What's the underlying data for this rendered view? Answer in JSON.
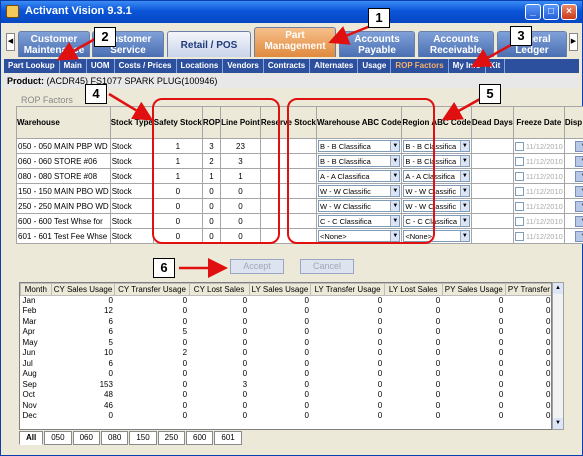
{
  "window": {
    "title": "Activant Vision 9.3.1"
  },
  "tabs": [
    {
      "label": "Customer Maintenance"
    },
    {
      "label": "Customer Service"
    },
    {
      "label": "Retail / POS"
    },
    {
      "label": "Part Management"
    },
    {
      "label": "Accounts Payable"
    },
    {
      "label": "Accounts Receivable"
    },
    {
      "label": "General Ledger"
    }
  ],
  "subnav": [
    "Part Lookup",
    "Main",
    "UOM",
    "Costs / Prices",
    "Locations",
    "Vendors",
    "Contracts",
    "Alternates",
    "Usage",
    "ROP Factors",
    "My Info",
    "Kit"
  ],
  "product": {
    "label": "Product:",
    "value": "(ACDR45) FS1077 SPARK PLUG(100946)"
  },
  "section": {
    "label": "ROP Factors"
  },
  "grid": {
    "headers": [
      "Warehouse",
      "Stock Type",
      "Safety Stock",
      "ROP",
      "Line Point",
      "Reserve Stock",
      "Warehouse ABC Code",
      "Region ABC Code",
      "Dead Days",
      "Freeze Date",
      "Disp Calc"
    ],
    "rows": [
      {
        "warehouse": "050 - 050 MAIN PBP WD",
        "type": "Stock",
        "safety": "1",
        "rop": "3",
        "line": "23",
        "wabc": "B - B Classifica",
        "rabc": "B - B Classifica",
        "date": "11/12/2010"
      },
      {
        "warehouse": "060 - 060 STORE #06",
        "type": "Stock",
        "safety": "1",
        "rop": "2",
        "line": "3",
        "wabc": "B - B Classifica",
        "rabc": "B - B Classifica",
        "date": "11/12/2010"
      },
      {
        "warehouse": "080 - 080 STORE #08",
        "type": "Stock",
        "safety": "1",
        "rop": "1",
        "line": "1",
        "wabc": "A - A Classifica",
        "rabc": "A - A Classifica",
        "date": "11/12/2010"
      },
      {
        "warehouse": "150 - 150 MAIN PBO WD",
        "type": "Stock",
        "safety": "0",
        "rop": "0",
        "line": "0",
        "wabc": "W - W Classific",
        "rabc": "W - W Classific",
        "date": "11/12/2010"
      },
      {
        "warehouse": "250 - 250 MAIN PBO WD",
        "type": "Stock",
        "safety": "0",
        "rop": "0",
        "line": "0",
        "wabc": "W - W Classific",
        "rabc": "W - W Classific",
        "date": "11/12/2010"
      },
      {
        "warehouse": "600 - 600 Test Whse for",
        "type": "Stock",
        "safety": "0",
        "rop": "0",
        "line": "0",
        "wabc": "C - C Classifica",
        "rabc": "C - C Classifica",
        "date": "11/12/2010"
      },
      {
        "warehouse": "601 - 601 Test Fee Whse",
        "type": "Stock",
        "safety": "0",
        "rop": "0",
        "line": "0",
        "wabc": "<None>",
        "rabc": "<None>",
        "date": "11/12/2010"
      }
    ],
    "calc_label": "*"
  },
  "buttons": {
    "accept": "Accept",
    "cancel": "Cancel"
  },
  "usage": {
    "headers": [
      "Month",
      "CY Sales Usage",
      "CY Transfer Usage",
      "CY Lost Sales",
      "LY Sales Usage",
      "LY Transfer Usage",
      "LY Lost Sales",
      "PY Sales Usage",
      "PY Transfer"
    ],
    "rows": [
      [
        "Jan",
        "0",
        "0",
        "0",
        "0",
        "0",
        "0",
        "0",
        "0"
      ],
      [
        "Feb",
        "12",
        "0",
        "0",
        "0",
        "0",
        "0",
        "0",
        "0"
      ],
      [
        "Mar",
        "6",
        "0",
        "0",
        "0",
        "0",
        "0",
        "0",
        "0"
      ],
      [
        "Apr",
        "6",
        "5",
        "0",
        "0",
        "0",
        "0",
        "0",
        "0"
      ],
      [
        "May",
        "5",
        "0",
        "0",
        "0",
        "0",
        "0",
        "0",
        "0"
      ],
      [
        "Jun",
        "10",
        "2",
        "0",
        "0",
        "0",
        "0",
        "0",
        "0"
      ],
      [
        "Jul",
        "6",
        "0",
        "0",
        "0",
        "0",
        "0",
        "0",
        "0"
      ],
      [
        "Aug",
        "0",
        "0",
        "0",
        "0",
        "0",
        "0",
        "0",
        "0"
      ],
      [
        "Sep",
        "153",
        "0",
        "3",
        "0",
        "0",
        "0",
        "0",
        "0"
      ],
      [
        "Oct",
        "48",
        "0",
        "0",
        "0",
        "0",
        "0",
        "0",
        "0"
      ],
      [
        "Nov",
        "46",
        "0",
        "0",
        "0",
        "0",
        "0",
        "0",
        "0"
      ],
      [
        "Dec",
        "0",
        "0",
        "0",
        "0",
        "0",
        "0",
        "0",
        "0"
      ]
    ]
  },
  "bottom_tabs": [
    "All",
    "050",
    "060",
    "080",
    "150",
    "250",
    "600",
    "601"
  ],
  "callouts": [
    "1",
    "2",
    "3",
    "4",
    "5",
    "6"
  ],
  "colors": {
    "annotation": "#e01010",
    "active_tab": "#e0893d",
    "nav_bar": "#2c4f9e"
  }
}
